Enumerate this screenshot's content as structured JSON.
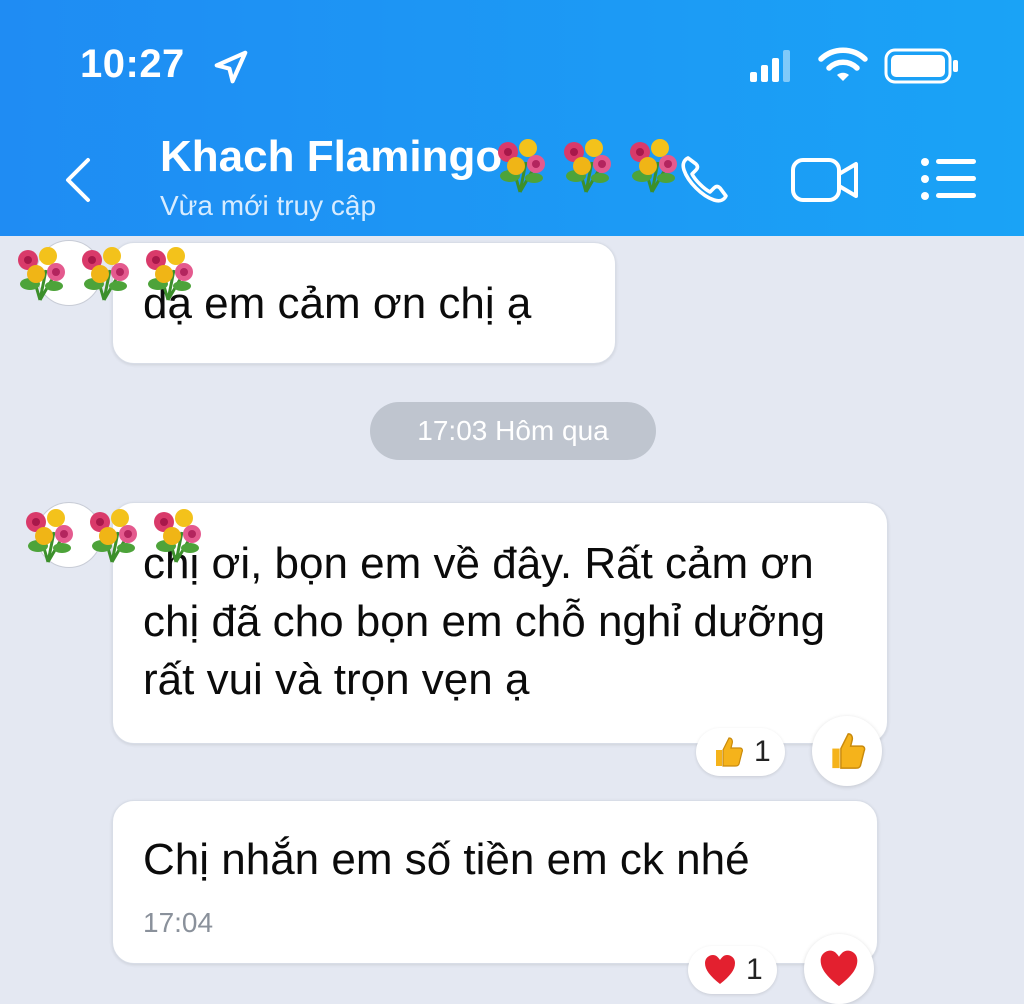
{
  "status_bar": {
    "time": "10:27",
    "icons": [
      "location-arrow-icon",
      "signal-icon",
      "wifi-icon",
      "battery-icon"
    ]
  },
  "header": {
    "contact_name": "Khach Flamingo",
    "status": "Vừa mới truy cập",
    "actions": [
      "phone-icon",
      "video-call-icon",
      "menu-icon"
    ],
    "accent": "#1f8cf3"
  },
  "messages": [
    {
      "text": "dạ em cảm ơn chị ạ"
    },
    {
      "text": "chị ơi, bọn em về đây. Rất cảm ơn chị đã cho bọn em chỗ nghỉ dưỡng rất vui và trọn vẹn ạ",
      "reaction": {
        "icon": "thumbs-up-icon",
        "count": "1"
      }
    },
    {
      "text": "Chị nhắn em số tiền em ck nhé",
      "time": "17:04",
      "reaction": {
        "icon": "heart-icon",
        "count": "1"
      }
    }
  ],
  "time_separator": "17:03 Hôm qua"
}
